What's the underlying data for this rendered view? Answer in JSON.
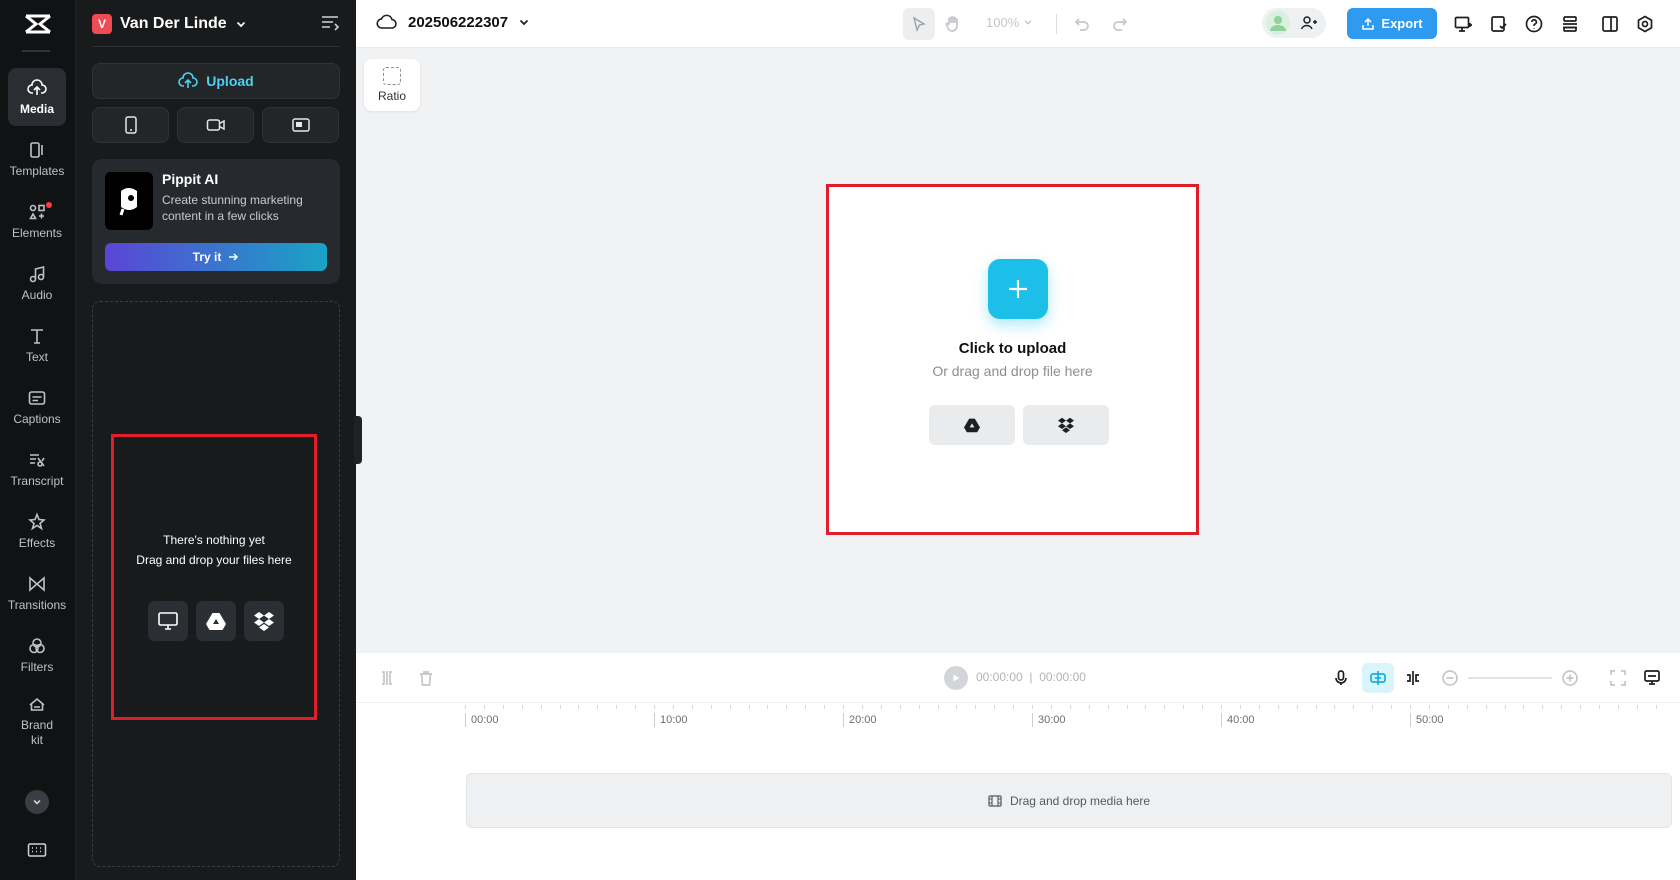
{
  "rail": {
    "items": [
      {
        "label": "Media",
        "icon": "cloud-upload-icon"
      },
      {
        "label": "Templates",
        "icon": "templates-icon"
      },
      {
        "label": "Elements",
        "icon": "elements-icon"
      },
      {
        "label": "Audio",
        "icon": "music-note-icon"
      },
      {
        "label": "Text",
        "icon": "text-icon"
      },
      {
        "label": "Captions",
        "icon": "captions-icon"
      },
      {
        "label": "Transcript",
        "icon": "transcript-icon"
      },
      {
        "label": "Effects",
        "icon": "effects-icon"
      },
      {
        "label": "Transitions",
        "icon": "transitions-icon"
      },
      {
        "label": "Filters",
        "icon": "filters-icon"
      },
      {
        "label": "Brand kit",
        "icon": "brand-kit-icon"
      }
    ],
    "active_item": "Media"
  },
  "panel": {
    "workspace_initial": "V",
    "workspace_name": "Van Der Linde",
    "upload_label": "Upload",
    "promo": {
      "title": "Pippit AI",
      "description": "Create stunning marketing content in a few clicks",
      "button": "Try it"
    },
    "empty": {
      "line1": "There's nothing yet",
      "line2": "Drag and drop your files here"
    }
  },
  "topbar": {
    "project_name": "202506222307",
    "zoom": "100%",
    "export_label": "Export"
  },
  "canvas": {
    "ratio_label": "Ratio",
    "upload_title": "Click to upload",
    "upload_subtitle": "Or drag and drop file here"
  },
  "timeline": {
    "current_time": "00:00:00",
    "total_time": "00:00:00",
    "ruler": [
      "00:00",
      "10:00",
      "20:00",
      "30:00",
      "40:00",
      "50:00"
    ],
    "track_hint": "Drag and drop media here"
  },
  "colors": {
    "accent": "#1bbfe8",
    "export": "#2f9bf0",
    "highlight_border": "#e11d2a",
    "panel_bg": "#181a1c"
  }
}
